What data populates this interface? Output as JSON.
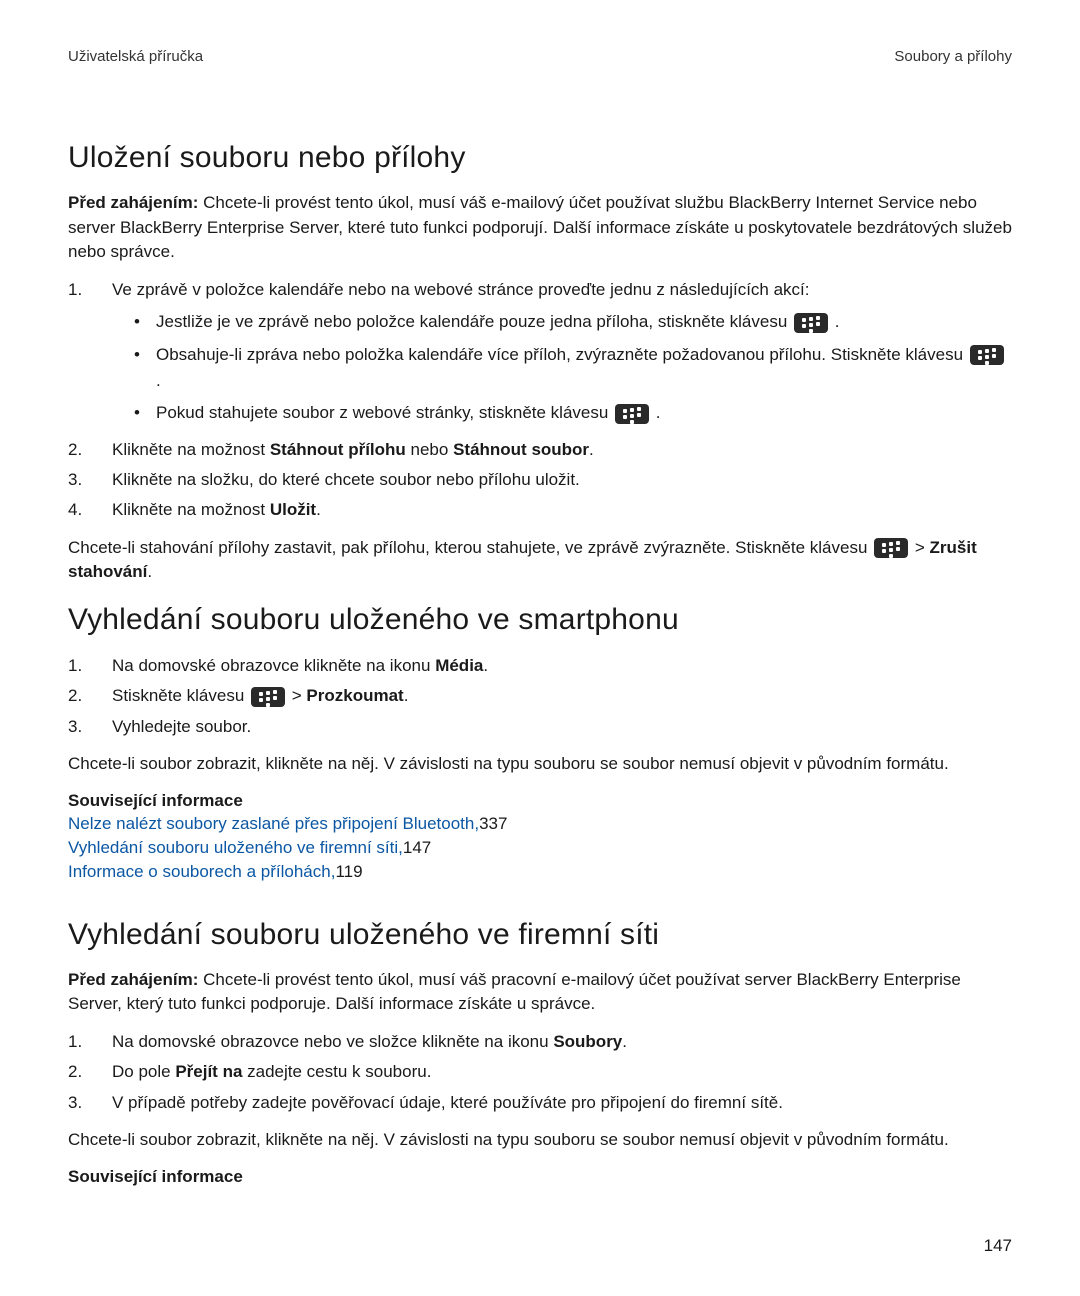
{
  "header": {
    "left": "Uživatelská příručka",
    "right": "Soubory a přílohy"
  },
  "section1": {
    "title": "Uložení souboru nebo přílohy",
    "before_label": "Před zahájením:",
    "before_text": " Chcete-li provést tento úkol, musí váš e-mailový účet používat službu BlackBerry Internet Service nebo server BlackBerry Enterprise Server, které tuto funkci podporují. Další informace získáte u poskytovatele bezdrátových služeb nebo správce.",
    "step1": "Ve zprávě v položce kalendáře nebo na webové stránce proveďte jednu z následujících akcí:",
    "b1_pre": "Jestliže je ve zprávě nebo položce kalendáře pouze jedna příloha, stiskněte klávesu ",
    "b1_post": " .",
    "b2_pre": "Obsahuje-li zpráva nebo položka kalendáře více příloh, zvýrazněte požadovanou přílohu. Stiskněte klávesu ",
    "b2_post": " .",
    "b3_pre": "Pokud stahujete soubor z webové stránky, stiskněte klávesu ",
    "b3_post": " .",
    "step2_a": "Klikněte na možnost ",
    "step2_b": "Stáhnout přílohu",
    "step2_c": " nebo ",
    "step2_d": "Stáhnout soubor",
    "step2_e": ".",
    "step3": "Klikněte na složku, do které chcete soubor nebo přílohu uložit.",
    "step4_a": "Klikněte na možnost ",
    "step4_b": "Uložit",
    "step4_c": ".",
    "stop_a": "Chcete-li stahování přílohy zastavit, pak přílohu, kterou stahujete, ve zprávě zvýrazněte. Stiskněte klávesu ",
    "stop_b": " > ",
    "stop_c": "Zrušit stahování",
    "stop_d": "."
  },
  "section2": {
    "title": "Vyhledání souboru uloženého ve smartphonu",
    "step1_a": "Na domovské obrazovce klikněte na ikonu ",
    "step1_b": "Média",
    "step1_c": ".",
    "step2_a": "Stiskněte klávesu ",
    "step2_b": " > ",
    "step2_c": "Prozkoumat",
    "step2_d": ".",
    "step3": "Vyhledejte soubor.",
    "note": "Chcete-li soubor zobrazit, klikněte na něj. V závislosti na typu souboru se soubor nemusí objevit v původním formátu.",
    "rel_title": "Související informace",
    "rel1_link": "Nelze nalézt soubory zaslané přes připojení Bluetooth,",
    "rel1_pg": "337",
    "rel2_link": "Vyhledání souboru uloženého ve firemní síti,",
    "rel2_pg": "147",
    "rel3_link": "Informace o souborech a přílohách,",
    "rel3_pg": "119"
  },
  "section3": {
    "title": "Vyhledání souboru uloženého ve firemní síti",
    "before_label": "Před zahájením:",
    "before_text": " Chcete-li provést tento úkol, musí váš pracovní e-mailový účet používat server BlackBerry Enterprise Server, který tuto funkci podporuje. Další informace získáte u správce.",
    "step1_a": "Na domovské obrazovce nebo ve složce klikněte na ikonu ",
    "step1_b": "Soubory",
    "step1_c": ".",
    "step2_a": "Do pole ",
    "step2_b": "Přejít na",
    "step2_c": " zadejte cestu k souboru.",
    "step3": "V případě potřeby zadejte pověřovací údaje, které používáte pro připojení do firemní sítě.",
    "note": "Chcete-li soubor zobrazit, klikněte na něj. V závislosti na typu souboru se soubor nemusí objevit v původním formátu.",
    "rel_title": "Související informace"
  },
  "page_number": "147"
}
